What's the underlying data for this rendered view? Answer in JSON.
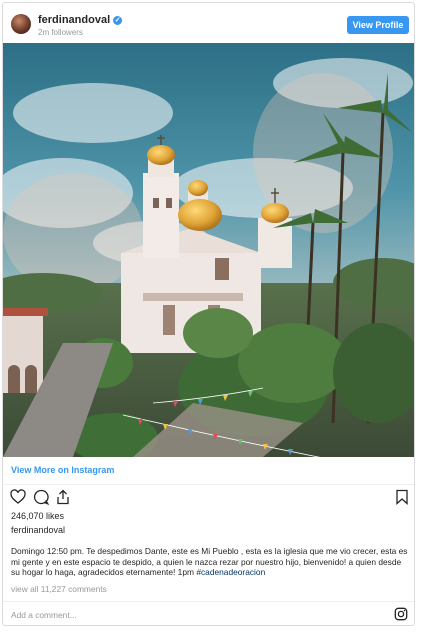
{
  "post": {
    "username": "ferdinandoval",
    "followers": "2m followers",
    "view_profile_label": "View Profile",
    "view_more_label": "View More on Instagram",
    "likes": "246,070 likes",
    "owner": "ferdinandoval",
    "caption_text": "Domingo 12:50 pm. Te despedimos Dante, este es Mi Pueblo , esta es la iglesia que me vio crecer, esta es mi gente y en este espacio te despido, a quien le nazca rezar por nuestro hijo, bienvenido! a quien desde su hogar lo haga, agradecidos eternamente! 1pm ",
    "caption_hashtag": "#cadenadeoracion",
    "view_comments": "view all 11,227 comments",
    "add_comment_placeholder": "Add a comment..."
  },
  "colors": {
    "accent": "#3897f0",
    "border": "#dbdbdb",
    "muted_text": "#999999"
  },
  "icons": [
    "verified-badge-icon",
    "heart-icon",
    "comment-icon",
    "share-icon",
    "bookmark-icon",
    "instagram-icon"
  ]
}
